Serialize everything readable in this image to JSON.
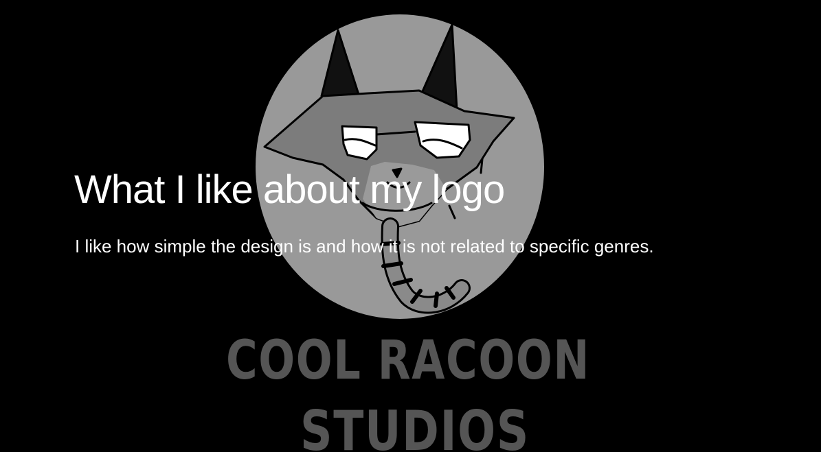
{
  "slide": {
    "title": "What I like about my logo",
    "body": "I like how simple the design is and how it is not related to specific genres."
  },
  "logo": {
    "line1": "COOL RACOON",
    "line2": "STUDIOS",
    "icon": "racoon-face-icon",
    "colors": {
      "background": "#000000",
      "circle": "#999999",
      "mask": "#777777",
      "lettering": "#555555",
      "text": "#ffffff"
    }
  }
}
